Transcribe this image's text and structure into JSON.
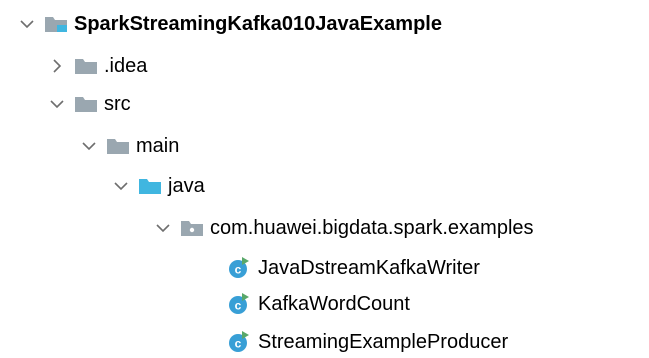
{
  "tree": {
    "root": {
      "label": "SparkStreamingKafka010JavaExample",
      "expanded": true,
      "icon": "module-folder-icon"
    },
    "idea": {
      "label": ".idea",
      "expanded": false,
      "icon": "folder-icon"
    },
    "src": {
      "label": "src",
      "expanded": true,
      "icon": "folder-icon"
    },
    "main": {
      "label": "main",
      "expanded": true,
      "icon": "folder-icon"
    },
    "java": {
      "label": "java",
      "expanded": true,
      "icon": "source-folder-icon"
    },
    "package": {
      "label": "com.huawei.bigdata.spark.examples",
      "expanded": true,
      "icon": "package-icon"
    },
    "classes": [
      {
        "label": "JavaDstreamKafkaWriter",
        "icon": "java-class-icon"
      },
      {
        "label": "KafkaWordCount",
        "icon": "java-class-icon"
      },
      {
        "label": "StreamingExampleProducer",
        "icon": "java-class-icon"
      }
    ]
  },
  "colors": {
    "folder_gray": "#9aa7b0",
    "source_blue": "#40b6e0",
    "class_blue": "#389fd6",
    "run_green": "#59a869",
    "chevron": "#6e6e6e"
  }
}
